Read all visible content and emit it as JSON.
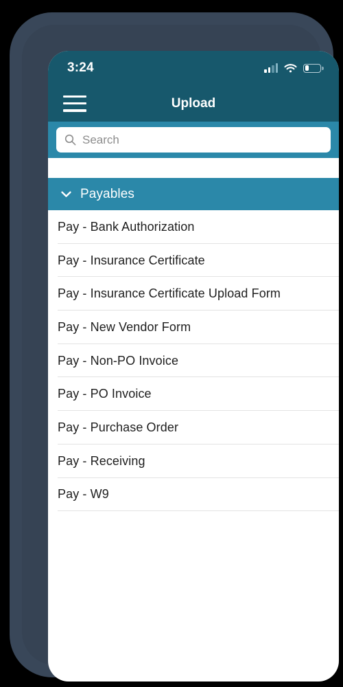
{
  "status_bar": {
    "time": "3:24",
    "signal_icon": "cellular-signal-icon",
    "signal_bars": 4,
    "wifi_icon": "wifi-icon",
    "battery_icon": "battery-icon",
    "battery_level_percent": 24
  },
  "nav_bar": {
    "menu_icon": "hamburger-menu-icon",
    "title": "Upload"
  },
  "search": {
    "icon": "search-icon",
    "value": "",
    "placeholder": "Search"
  },
  "section": {
    "chevron_icon": "chevron-down-icon",
    "title": "Payables",
    "expanded": true
  },
  "list": {
    "items": [
      {
        "label": "Pay - Bank Authorization"
      },
      {
        "label": "Pay - Insurance Certificate"
      },
      {
        "label": "Pay - Insurance Certificate Upload Form"
      },
      {
        "label": "Pay - New Vendor Form"
      },
      {
        "label": "Pay - Non-PO Invoice"
      },
      {
        "label": "Pay - PO Invoice"
      },
      {
        "label": "Pay - Purchase Order"
      },
      {
        "label": "Pay - Receiving"
      },
      {
        "label": "Pay - W9"
      }
    ]
  },
  "colors": {
    "navbar": "#17586c",
    "accent": "#2b88a9",
    "screen_background": "#ffffff",
    "text_primary": "#1d1d1d",
    "placeholder": "#8c8c8c",
    "divider": "#e3e3e3",
    "phone_frame": "#394759",
    "page_background": "#000000"
  }
}
